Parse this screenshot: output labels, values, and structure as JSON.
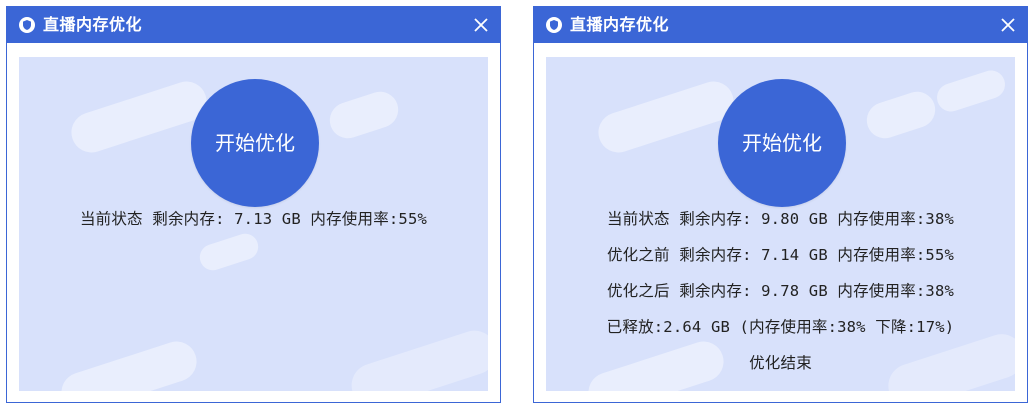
{
  "windows": [
    {
      "title": "直播内存优化",
      "start_button": "开始优化",
      "lines": [
        "当前状态 剩余内存: 7.13 GB 内存使用率:55%"
      ]
    },
    {
      "title": "直播内存优化",
      "start_button": "开始优化",
      "lines": [
        "当前状态 剩余内存: 9.80 GB 内存使用率:38%",
        "优化之前 剩余内存: 7.14 GB 内存使用率:55%",
        "优化之后 剩余内存: 9.78 GB 内存使用率:38%",
        "已释放:2.64 GB (内存使用率:38% 下降:17%)",
        "优化结束"
      ]
    }
  ],
  "icons": {
    "app": "shield-icon",
    "close": "close-icon"
  },
  "colors": {
    "accent": "#3b66d6",
    "panel_bg": "#d8e1fb",
    "text": "#222222",
    "title_text": "#ffffff"
  }
}
